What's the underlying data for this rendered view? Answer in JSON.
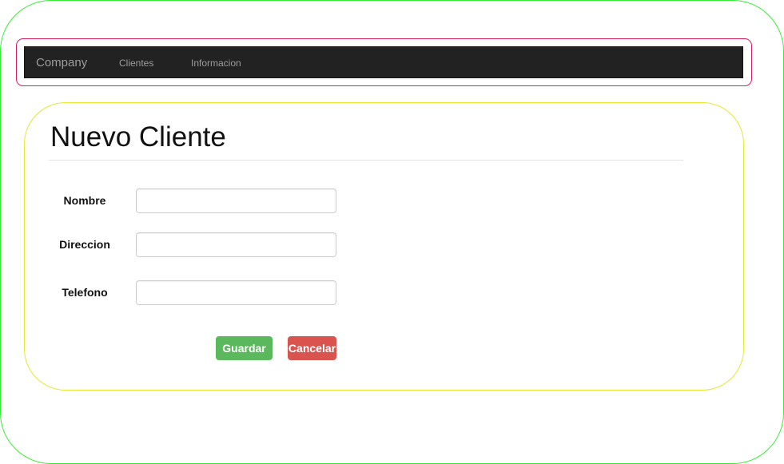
{
  "navbar": {
    "brand": "Company",
    "links": [
      {
        "label": "Clientes"
      },
      {
        "label": "Informacion"
      }
    ]
  },
  "form": {
    "title": "Nuevo Cliente",
    "fields": [
      {
        "label": "Nombre",
        "value": "",
        "placeholder": ""
      },
      {
        "label": "Direccion",
        "value": "",
        "placeholder": ""
      },
      {
        "label": "Telefono",
        "value": "",
        "placeholder": ""
      }
    ],
    "save_label": "Guardar",
    "cancel_label": "Cancelar"
  },
  "colors": {
    "navbar_bg": "#222222",
    "save_button": "#5cb85c",
    "cancel_button": "#d9534f",
    "outer_frame": "#33ee33",
    "nav_frame": "#d81b60",
    "content_frame": "#e5e833"
  }
}
